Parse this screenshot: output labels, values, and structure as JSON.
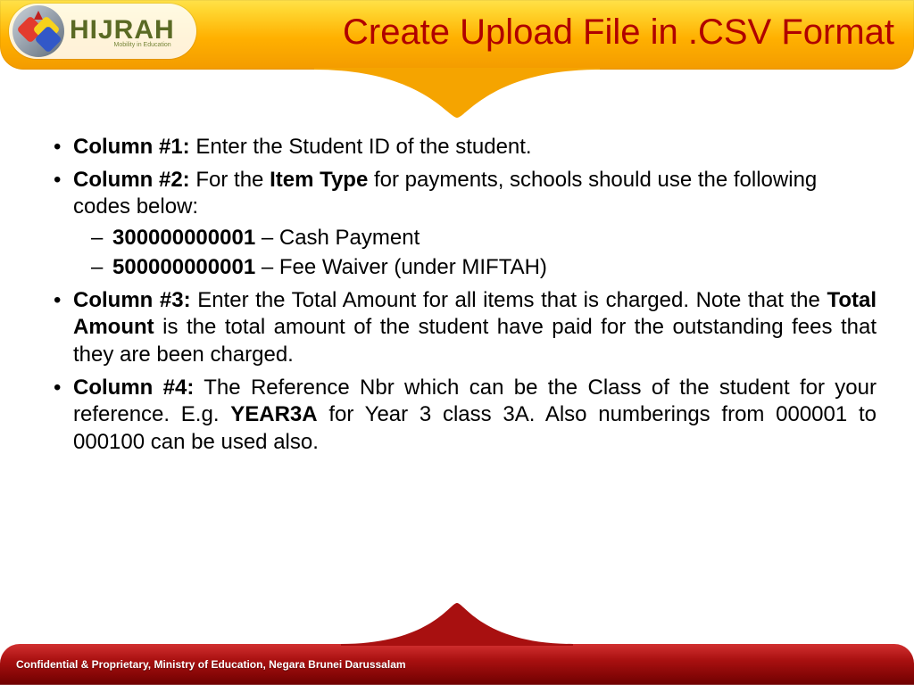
{
  "header": {
    "logo": {
      "main": "HIJRAH",
      "tagline": "Mobility in Education"
    },
    "title": "Create Upload File in .CSV Format"
  },
  "content": {
    "col1": {
      "label": "Column #1:",
      "text": " Enter the Student ID of the student."
    },
    "col2": {
      "label": "Column #2:",
      "lead": " For the ",
      "bold1": "Item Type",
      "tail": " for payments, schools should use the following codes below:",
      "code1": "300000000001",
      "code1_desc": " – Cash Payment",
      "code2": "500000000001",
      "code2_desc": " – Fee Waiver (under MIFTAH)"
    },
    "col3": {
      "label": "Column #3:",
      "t1": " Enter the Total Amount for all items that is charged. Note that the ",
      "bold1": "Total Amount",
      "t2": " is the total amount of the student have paid for the outstanding fees that they are been charged."
    },
    "col4": {
      "label": "Column #4:",
      "t1": " The Reference Nbr which can be the Class of the student for your reference. E.g. ",
      "bold1": "YEAR3A",
      "t2": " for Year 3 class 3A. Also numberings from 000001 to 000100 can be used also."
    }
  },
  "footer": {
    "text": "Confidential & Proprietary, Ministry of Education, Negara Brunei Darussalam"
  }
}
